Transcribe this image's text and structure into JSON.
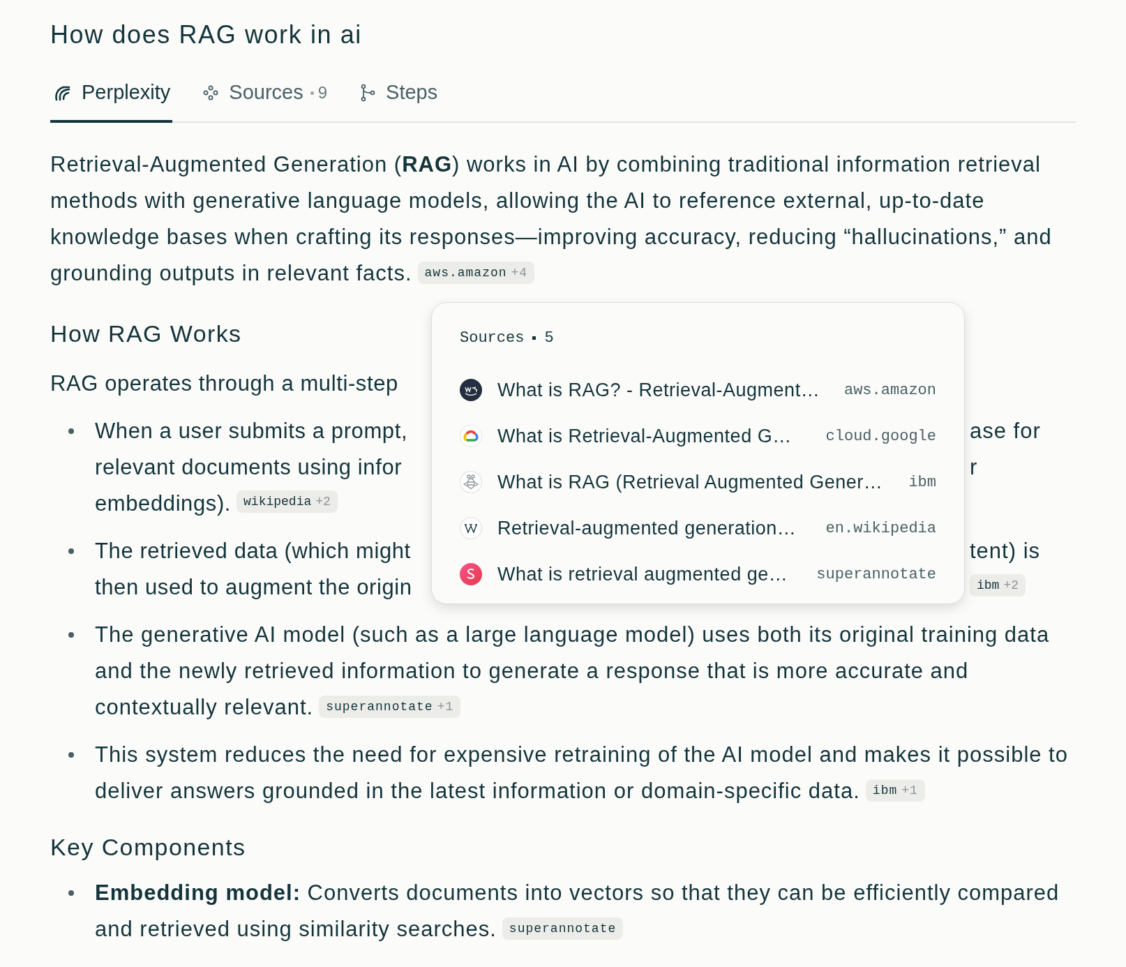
{
  "title": "How does RAG work in ai",
  "tabs": [
    {
      "label": "Perplexity",
      "selected": true
    },
    {
      "label": "Sources",
      "count": "9",
      "selected": false
    },
    {
      "label": "Steps",
      "selected": false
    }
  ],
  "intro": {
    "text": "Retrieval-Augmented Generation (**RAG**) works in AI by combining traditional information retrieval methods with generative language models, allowing the AI to reference external, up-to-date knowledge bases when crafting its responses—improving accuracy, reducing “hallucinations,” and grounding outputs in relevant facts.",
    "citation": {
      "source": "aws.amazon",
      "more": "+4"
    }
  },
  "section_1": {
    "heading": "How RAG Works",
    "clipped_lines": [
      {
        "kind": "paragraph",
        "text": "RAG operates through a multi-step"
      },
      {
        "kind": "bullet_start",
        "text": "When a user submits a prompt,",
        "right_text": "ase for"
      },
      {
        "kind": "bullet_more",
        "text": "relevant documents using infor",
        "right_text": "r"
      },
      {
        "kind": "bullet_more",
        "text": "embeddings).",
        "citation": {
          "source": "wikipedia",
          "more": "+2"
        }
      },
      {
        "kind": "bullet_start",
        "text": "The retrieved data (which might",
        "right_text": "tent) is"
      },
      {
        "kind": "bullet_more",
        "text": "then used to augment the origin",
        "right_citation": {
          "source": "ibm",
          "more": "+2"
        }
      }
    ],
    "bullets": [
      {
        "text": "The generative AI model (such as a large language model) uses both its original training data and the newly retrieved information to generate a response that is more accurate and contextually relevant.",
        "citation": {
          "source": "superannotate",
          "more": "+1"
        }
      },
      {
        "text": "This system reduces the need for expensive retraining of the AI model and makes it possible to deliver answers grounded in the latest information or domain-specific data.",
        "citation": {
          "source": "ibm",
          "more": "+1"
        }
      }
    ]
  },
  "section_2": {
    "heading": "Key Components",
    "bullets": [
      {
        "text": "**Embedding model:** Converts documents into vectors so that they can be efficiently compared and retrieved using similarity searches.",
        "citation": {
          "source": "superannotate"
        }
      }
    ]
  },
  "sources_popover": {
    "title": "Sources",
    "count": "5",
    "items": [
      {
        "title": "What is RAG? - Retrieval-Augment…",
        "domain": "aws.amazon"
      },
      {
        "title": "What is Retrieval-Augmented G…",
        "domain": "cloud.google"
      },
      {
        "title": "What is RAG (Retrieval Augmented Gener…",
        "domain": "ibm"
      },
      {
        "title": "Retrieval-augmented generation…",
        "domain": "en.wikipedia"
      },
      {
        "title": "What is retrieval augmented ge…",
        "domain": "superannotate"
      }
    ]
  }
}
